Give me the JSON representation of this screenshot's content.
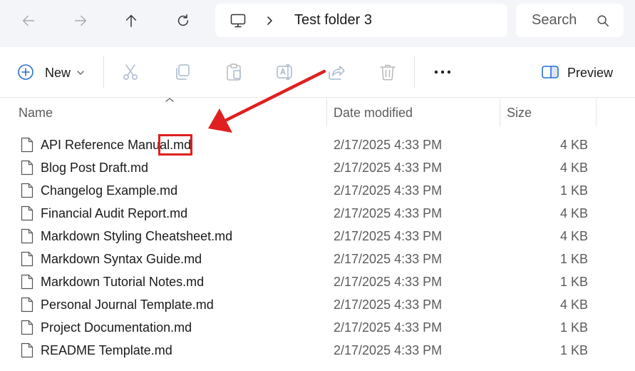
{
  "address": {
    "path": "Test folder 3"
  },
  "search": {
    "placeholder": "Search"
  },
  "toolbar": {
    "new_label": "New",
    "preview_label": "Preview"
  },
  "columns": {
    "name": "Name",
    "date": "Date modified",
    "size": "Size"
  },
  "files": [
    {
      "name": "API Reference Manual.md",
      "date": "2/17/2025 4:33 PM",
      "size": "4 KB"
    },
    {
      "name": "Blog Post Draft.md",
      "date": "2/17/2025 4:33 PM",
      "size": "4 KB"
    },
    {
      "name": "Changelog Example.md",
      "date": "2/17/2025 4:33 PM",
      "size": "1 KB"
    },
    {
      "name": "Financial Audit Report.md",
      "date": "2/17/2025 4:33 PM",
      "size": "4 KB"
    },
    {
      "name": "Markdown Styling Cheatsheet.md",
      "date": "2/17/2025 4:33 PM",
      "size": "4 KB"
    },
    {
      "name": "Markdown Syntax Guide.md",
      "date": "2/17/2025 4:33 PM",
      "size": "1 KB"
    },
    {
      "name": "Markdown Tutorial Notes.md",
      "date": "2/17/2025 4:33 PM",
      "size": "1 KB"
    },
    {
      "name": "Personal Journal Template.md",
      "date": "2/17/2025 4:33 PM",
      "size": "4 KB"
    },
    {
      "name": "Project Documentation.md",
      "date": "2/17/2025 4:33 PM",
      "size": "1 KB"
    },
    {
      "name": "README Template.md",
      "date": "2/17/2025 4:33 PM",
      "size": "1 KB"
    }
  ],
  "colors": {
    "annotation": "#e02020",
    "topbar": "#f3f5f9",
    "icon_blue": "#2a6fd1"
  }
}
